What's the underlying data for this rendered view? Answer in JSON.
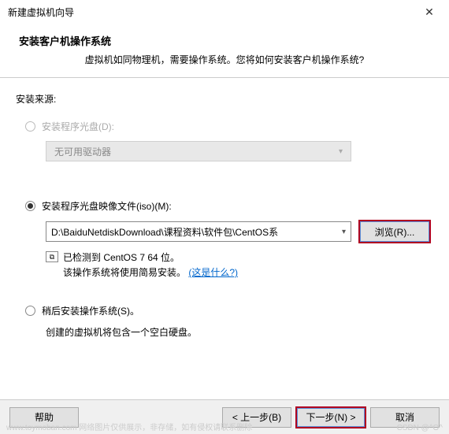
{
  "window": {
    "title": "新建虚拟机向导"
  },
  "header": {
    "heading": "安装客户机操作系统",
    "sub": "虚拟机如同物理机，需要操作系统。您将如何安装客户机操作系统?"
  },
  "section_label": "安装来源:",
  "options": {
    "disc": {
      "label": "安装程序光盘(D):",
      "dropdown_text": "无可用驱动器"
    },
    "iso": {
      "label": "安装程序光盘映像文件(iso)(M):",
      "path": "D:\\BaiduNetdiskDownload\\课程资料\\软件包\\CentOS系",
      "browse": "浏览(R)...",
      "detected_line1": "已检测到 CentOS 7 64 位。",
      "detected_line2_prefix": "该操作系统将使用简易安装。",
      "detected_link": "(这是什么?)"
    },
    "later": {
      "label": "稍后安装操作系统(S)。",
      "desc": "创建的虚拟机将包含一个空白硬盘。"
    }
  },
  "footer": {
    "help": "帮助",
    "back": "< 上一步(B)",
    "next": "下一步(N) >",
    "cancel": "取消"
  },
  "watermark": {
    "left": "www.toymoban.com 网络图片仅供展示，非存储，如有侵权请联系删除",
    "right": "CSDN @^O^"
  }
}
